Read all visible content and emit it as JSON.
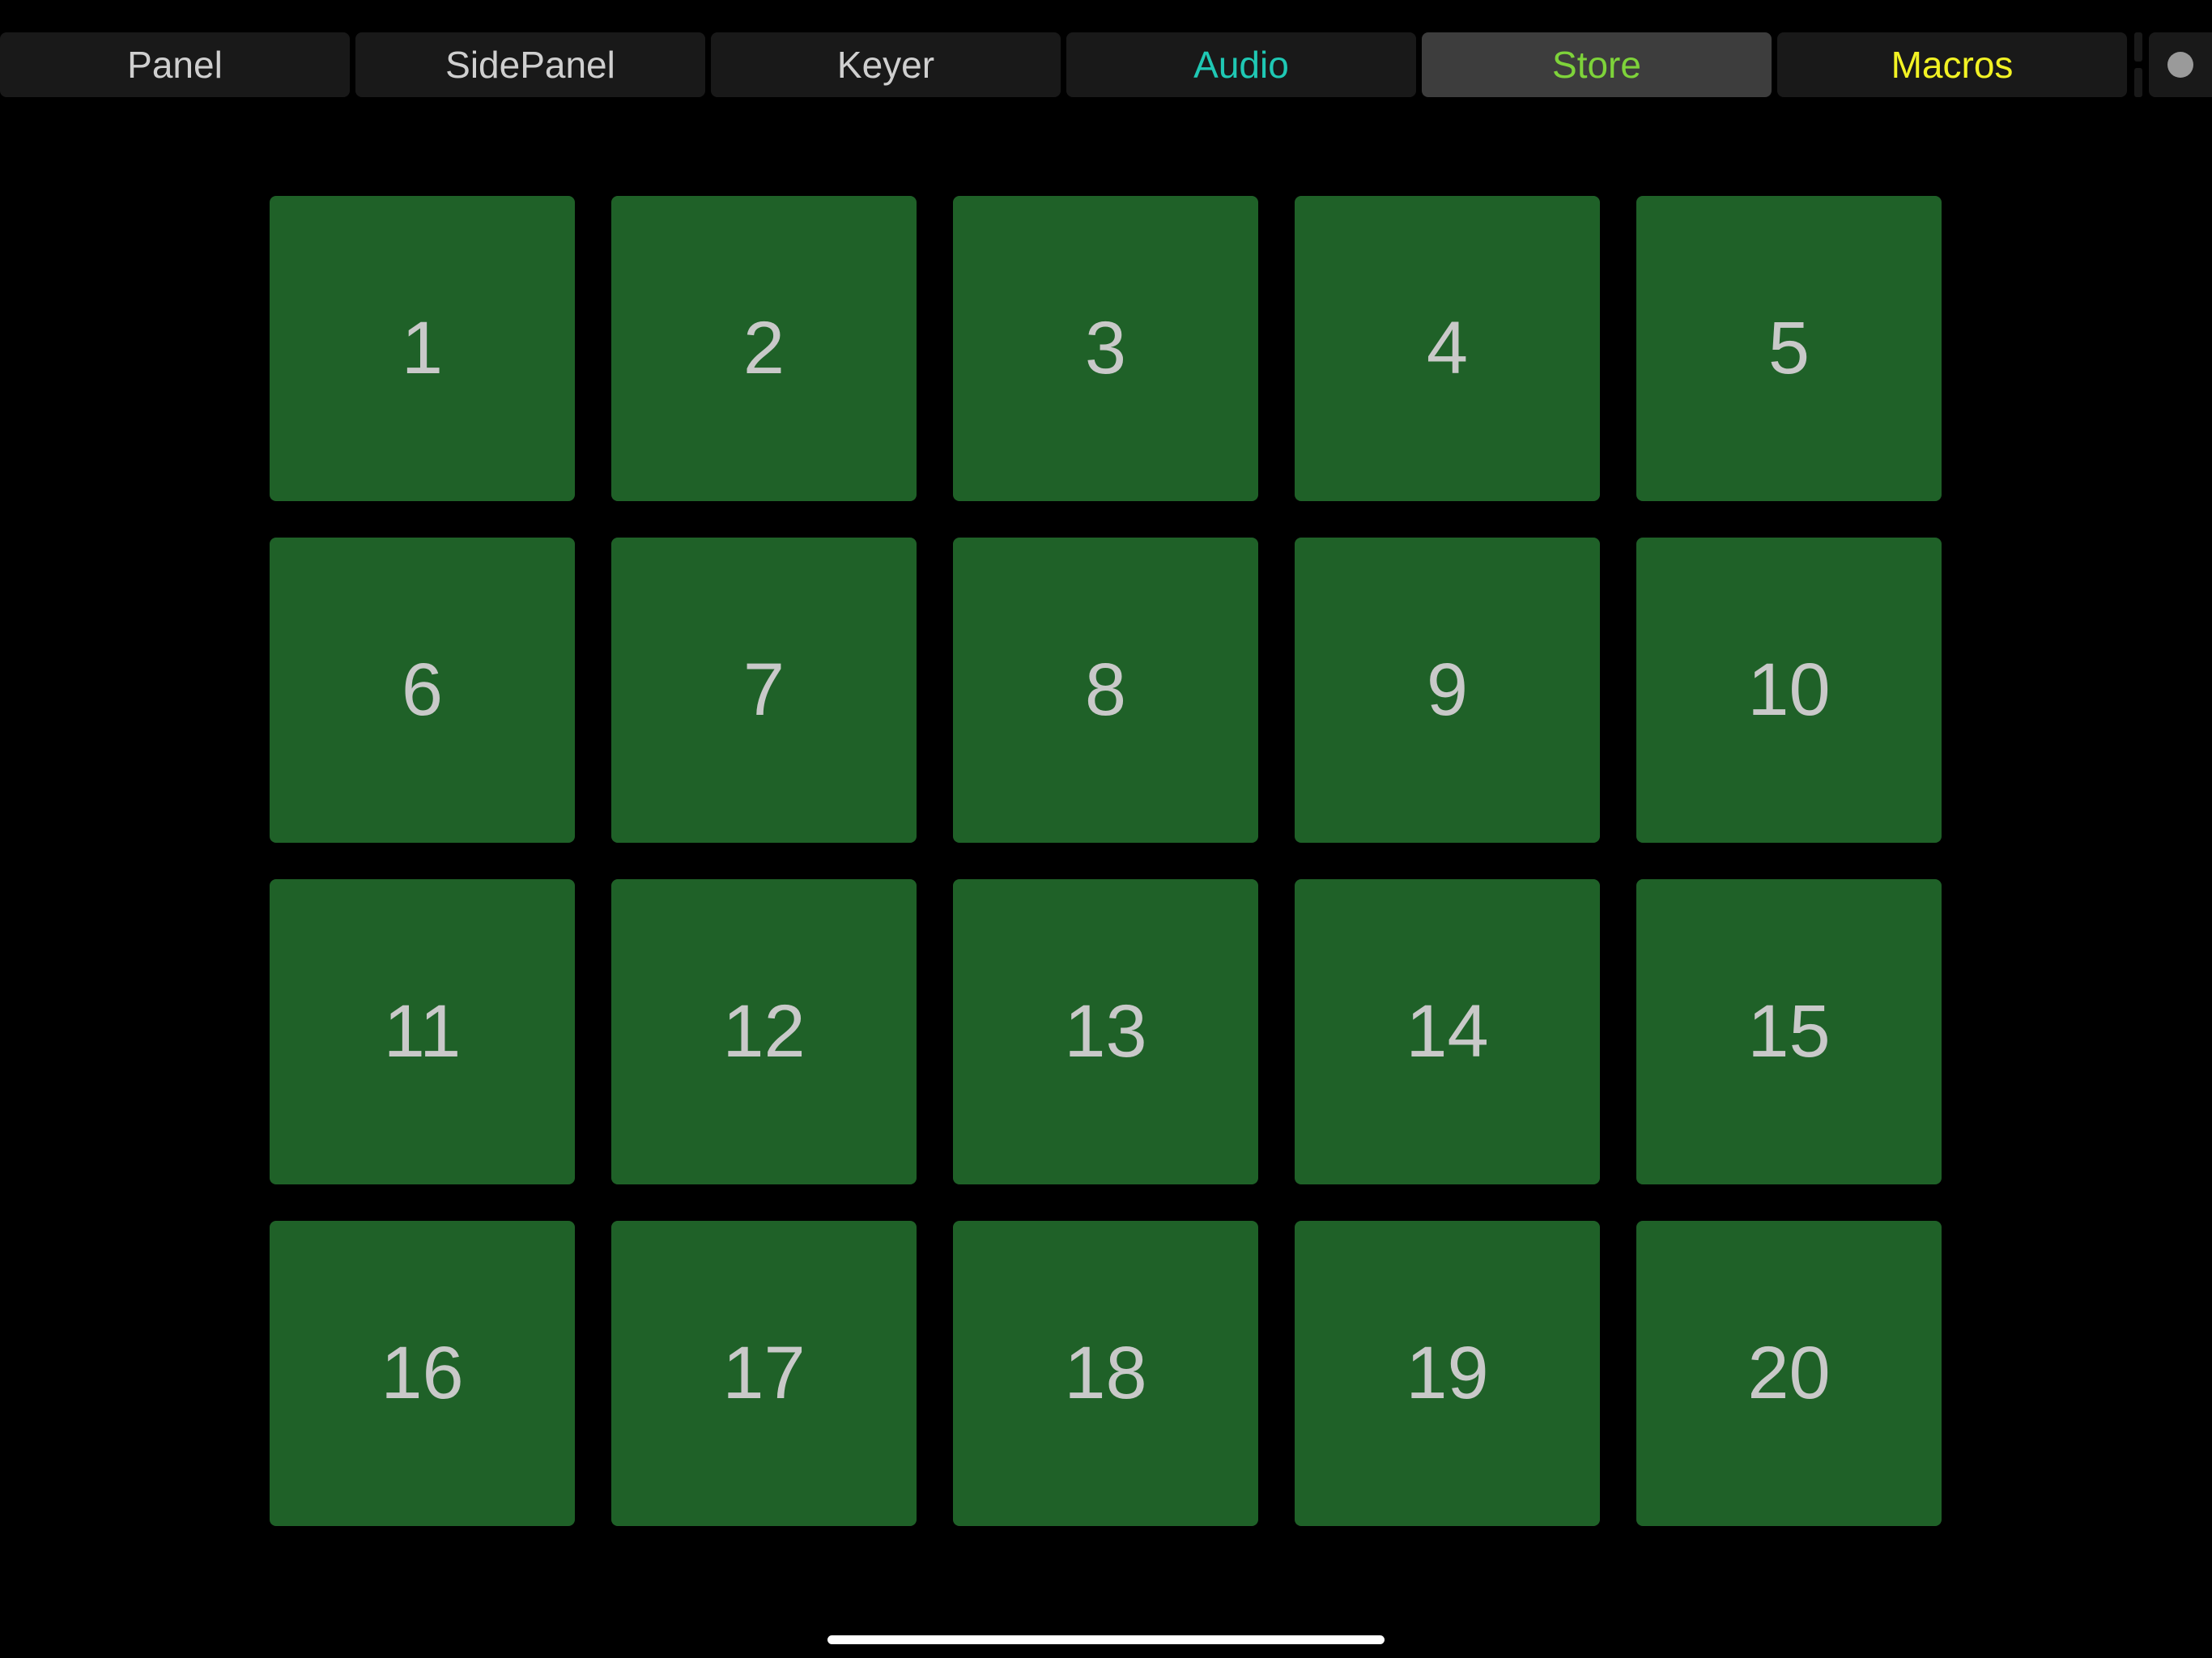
{
  "tabs": [
    {
      "label": "Panel",
      "color": "#cfcfcf",
      "active": false
    },
    {
      "label": "SidePanel",
      "color": "#cfcfcf",
      "active": false
    },
    {
      "label": "Keyer",
      "color": "#cfcfcf",
      "active": false
    },
    {
      "label": "Audio",
      "color": "#1fc8b4",
      "active": false
    },
    {
      "label": "Store",
      "color": "#7ed33a",
      "active": true
    },
    {
      "label": "Macros",
      "color": "#f2f224",
      "active": false
    }
  ],
  "more_icon": "dot-icon",
  "slots": [
    "1",
    "2",
    "3",
    "4",
    "5",
    "6",
    "7",
    "8",
    "9",
    "10",
    "11",
    "12",
    "13",
    "14",
    "15",
    "16",
    "17",
    "18",
    "19",
    "20"
  ],
  "colors": {
    "background": "#000000",
    "slot": "#1f6128",
    "slot_text": "#c9c9c9",
    "tab_bg": "#191919",
    "tab_active_bg": "#3d3d3d"
  }
}
